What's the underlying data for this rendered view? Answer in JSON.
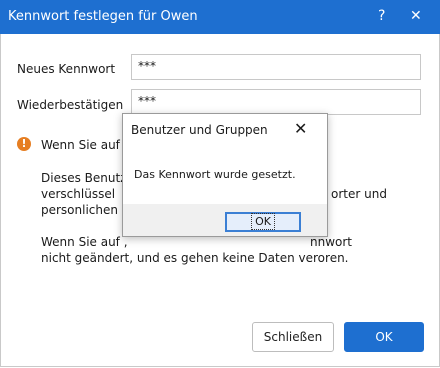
{
  "window": {
    "title": "Kennwort festlegen für Owen",
    "help_glyph": "?",
    "close_glyph": "✕"
  },
  "form": {
    "new_password_label": "Neues Kennwort",
    "new_password_value": "***",
    "confirm_label": "Wiederbestätigen",
    "confirm_value": "***"
  },
  "warning": {
    "icon_glyph": "!",
    "line1_left": "Wenn Sie auf ,",
    "line1_right": ":",
    "p1_l1": "Dieses Benutz",
    "p1_l2": "verschlüssel",
    "p1_l2_right": "orter und",
    "p1_l3": "personlichen  ",
    "p2_l1_left": "Wenn Sie auf ,",
    "p2_l1_right": "nnwort",
    "p2_l2": "nicht geändert, und es gehen keine Daten veroren."
  },
  "buttons": {
    "close_label": "Schließen",
    "ok_label": "OK"
  },
  "modal": {
    "title": "Benutzer und Gruppen",
    "close_glyph": "✕",
    "message": "Das Kennwort wurde gesetzt.",
    "ok_label": "OK"
  },
  "colors": {
    "accent": "#1e6fd0",
    "warning": "#e67e22"
  }
}
